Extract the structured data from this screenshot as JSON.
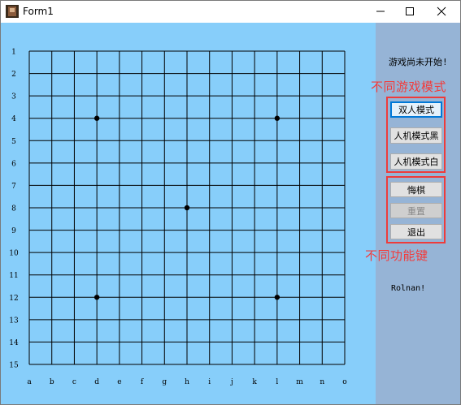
{
  "window": {
    "title": "Form1",
    "controls": [
      "minimize-icon",
      "maximize-icon",
      "close-icon"
    ]
  },
  "board": {
    "size": 15,
    "row_labels": [
      "1",
      "2",
      "3",
      "4",
      "5",
      "6",
      "7",
      "8",
      "9",
      "10",
      "11",
      "12",
      "13",
      "14",
      "15"
    ],
    "col_labels": [
      "a",
      "b",
      "c",
      "d",
      "e",
      "f",
      "g",
      "h",
      "i",
      "j",
      "k",
      "l",
      "m",
      "n",
      "o"
    ],
    "star_points": [
      {
        "col": "d",
        "row": 4
      },
      {
        "col": "l",
        "row": 4
      },
      {
        "col": "h",
        "row": 8
      },
      {
        "col": "d",
        "row": 12
      },
      {
        "col": "l",
        "row": 12
      }
    ]
  },
  "panel": {
    "status": "游戏尚未开始!",
    "mode_annotation": "不同游戏模式",
    "function_annotation": "不同功能键",
    "mode_buttons": {
      "two_player": "双人模式",
      "ai_black": "人机模式黑",
      "ai_white": "人机模式白"
    },
    "function_buttons": {
      "undo": "悔棋",
      "reset": "重置",
      "exit": "退出"
    },
    "author": "Rolnan!"
  },
  "colors": {
    "board_bg": "#87cefa",
    "panel_bg": "#96b4d6",
    "annotation": "#f23c3c",
    "grid": "#000000"
  }
}
